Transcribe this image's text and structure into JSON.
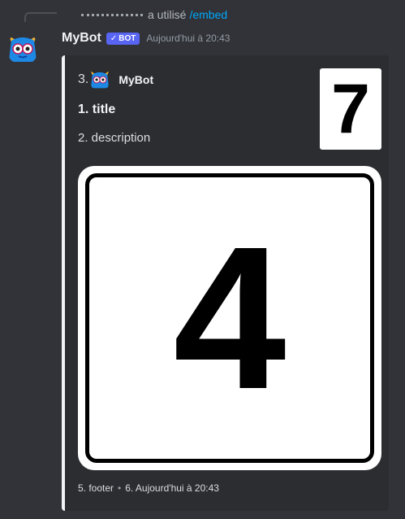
{
  "reply": {
    "text": "a utilisé",
    "command": "/embed"
  },
  "message": {
    "username": "MyBot",
    "badge": "BOT",
    "timestamp": "Aujourd'hui à 20:43"
  },
  "embed": {
    "author_number": "3.",
    "author_name": "MyBot",
    "title": "1. title",
    "description": "2. description",
    "thumbnail_value": "7",
    "image_value": "4",
    "footer_text": "5. footer",
    "footer_separator": "•",
    "footer_timestamp": "6. Aujourd'hui à 20:43",
    "accent_color": "#f2f3f5"
  },
  "icons": {
    "avatar": "blue-monster-avatar-icon",
    "badge_check": "check-icon"
  }
}
